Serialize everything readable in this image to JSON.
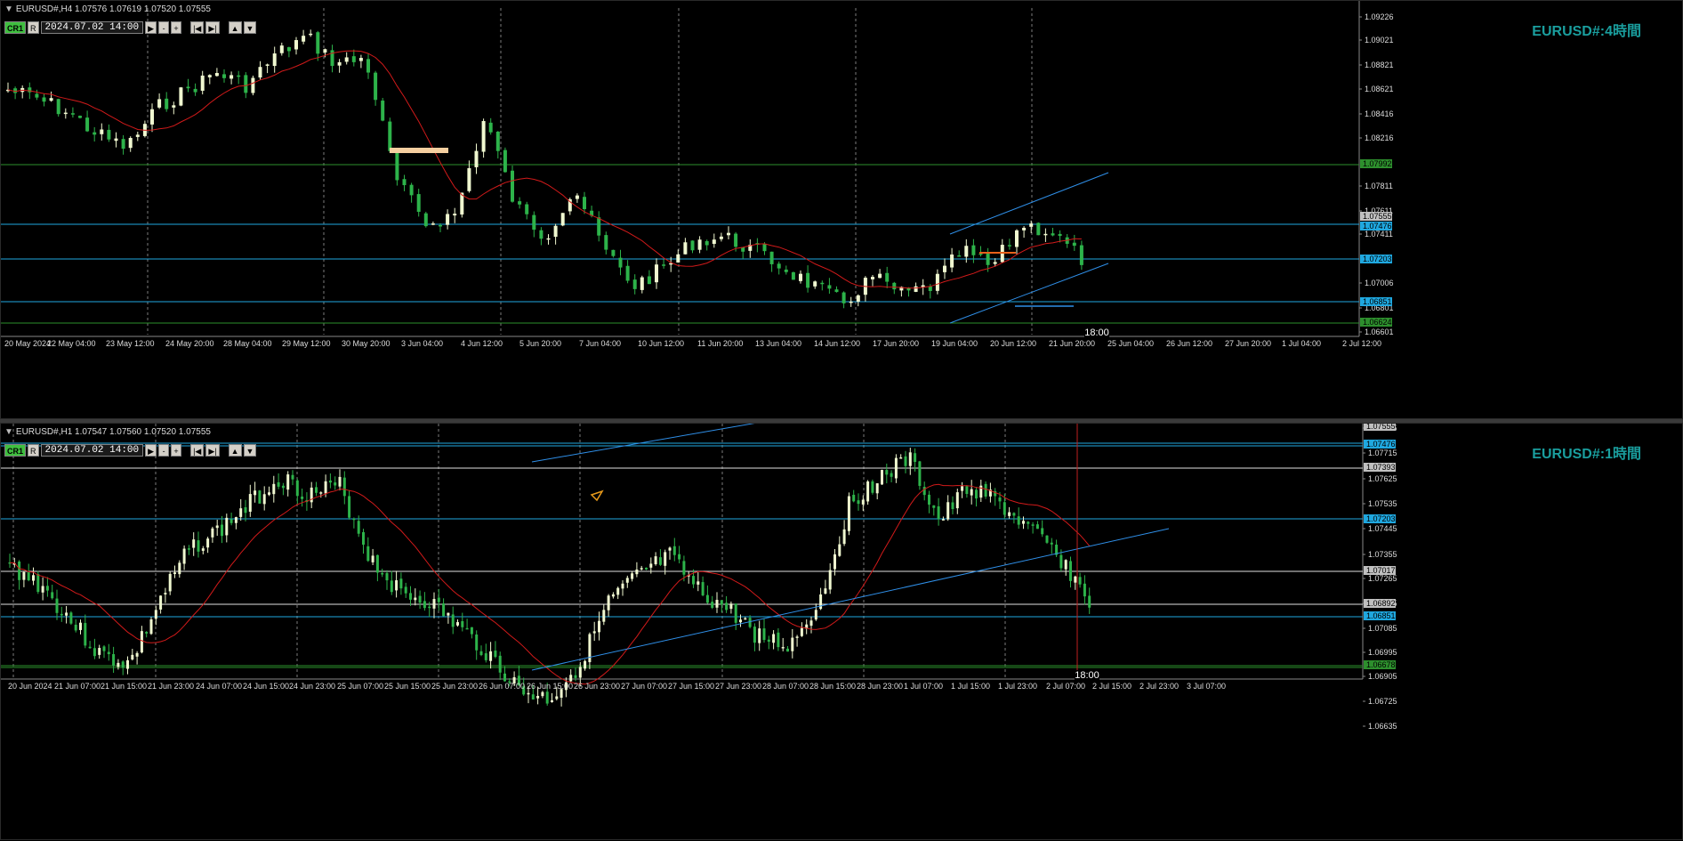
{
  "panes": [
    {
      "id": "h4",
      "header": "EURUSD#,H4  1.07576 1.07619 1.07520 1.07555",
      "cr_label": "CR1",
      "r_label": "R",
      "date_value": "2024.07.02 14:00",
      "title": "EURUSD#:4時間",
      "cursor_time": "18:00",
      "price_labels": [
        "1.09226",
        "1.09021",
        "1.08821",
        "1.08621",
        "1.08416",
        "1.08216",
        "1.07811",
        "1.07611",
        "1.07411",
        "1.07006",
        "1.06801",
        "1.06601"
      ],
      "highlight_labels": [
        {
          "text": "1.07992",
          "color": "#2d8f2d"
        },
        {
          "text": "1.07555",
          "color": "#c0c0c0"
        },
        {
          "text": "1.07476",
          "color": "#1fa8e0"
        },
        {
          "text": "1.07203",
          "color": "#1fa8e0"
        },
        {
          "text": "1.06851",
          "color": "#1fa8e0"
        },
        {
          "text": "1.06624",
          "color": "#2d8f2d"
        }
      ],
      "time_labels": [
        "20 May 2024",
        "22 May 04:00",
        "23 May 12:00",
        "24 May 20:00",
        "28 May 04:00",
        "29 May 12:00",
        "30 May 20:00",
        "3 Jun 04:00",
        "4 Jun 12:00",
        "5 Jun 20:00",
        "7 Jun 04:00",
        "10 Jun 12:00",
        "11 Jun 20:00",
        "13 Jun 04:00",
        "14 Jun 12:00",
        "17 Jun 20:00",
        "19 Jun 04:00",
        "20 Jun 12:00",
        "21 Jun 20:00",
        "25 Jun 04:00",
        "26 Jun 12:00",
        "27 Jun 20:00",
        "1 Jul 04:00",
        "2 Jul 12:00"
      ]
    },
    {
      "id": "h1",
      "header": "EURUSD#,H1  1.07547 1.07560 1.07520 1.07555",
      "cr_label": "CR1",
      "r_label": "R",
      "date_value": "2024.07.02 14:00",
      "title": "EURUSD#:1時間",
      "cursor_time": "18:00",
      "price_labels": [
        "1.07805",
        "1.07715",
        "1.07625",
        "1.07535",
        "1.07445",
        "1.07355",
        "1.07265",
        "1.07175",
        "1.07085",
        "1.06995",
        "1.06905",
        "1.06725",
        "1.06635"
      ],
      "highlight_labels": [
        {
          "text": "1.07555",
          "color": "#c0c0c0"
        },
        {
          "text": "1.07476",
          "color": "#1fa8e0"
        },
        {
          "text": "1.07393",
          "color": "#c0c0c0"
        },
        {
          "text": "1.07203",
          "color": "#1fa8e0"
        },
        {
          "text": "1.07017",
          "color": "#c0c0c0"
        },
        {
          "text": "1.06892",
          "color": "#c0c0c0"
        },
        {
          "text": "1.06851",
          "color": "#1fa8e0"
        },
        {
          "text": "1.06678",
          "color": "#2d8f2d"
        }
      ],
      "time_labels": [
        "20 Jun 2024",
        "21 Jun 07:00",
        "21 Jun 15:00",
        "21 Jun 23:00",
        "24 Jun 07:00",
        "24 Jun 15:00",
        "24 Jun 23:00",
        "25 Jun 07:00",
        "25 Jun 15:00",
        "25 Jun 23:00",
        "26 Jun 07:00",
        "26 Jun 15:00",
        "26 Jun 23:00",
        "27 Jun 07:00",
        "27 Jun 15:00",
        "27 Jun 23:00",
        "28 Jun 07:00",
        "28 Jun 15:00",
        "28 Jun 23:00",
        "1 Jul 07:00",
        "1 Jul 15:00",
        "1 Jul 23:00",
        "2 Jul 07:00",
        "2 Jul 15:00",
        "2 Jul 23:00",
        "3 Jul 07:00"
      ]
    }
  ],
  "colors": {
    "bull": "#f0f8d0",
    "bear": "#2db34a",
    "ma": "#d11a1a",
    "trend": "#2f8fe8",
    "hline_blue": "#1fa8e0",
    "hline_green": "#2d8f2d",
    "hline_white": "#e0e0e0",
    "title": "#1a9e9e"
  }
}
